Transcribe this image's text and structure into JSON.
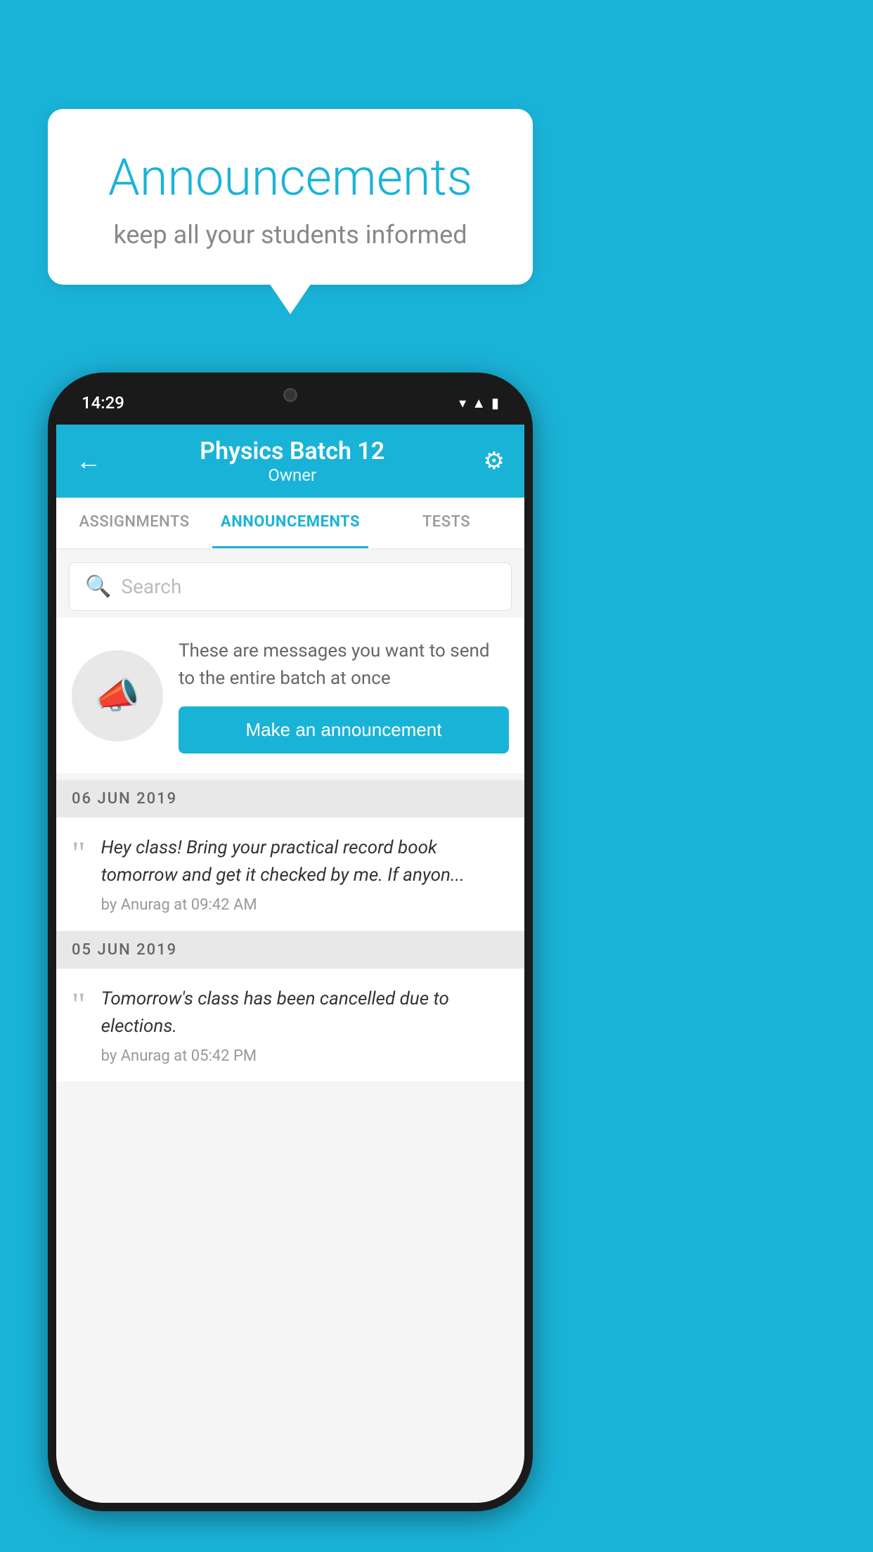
{
  "background_color": "#1ab3d8",
  "speech_bubble": {
    "title": "Announcements",
    "subtitle": "keep all your students informed"
  },
  "phone": {
    "status_bar": {
      "time": "14:29"
    },
    "header": {
      "title": "Physics Batch 12",
      "subtitle": "Owner",
      "back_label": "←"
    },
    "tabs": [
      {
        "label": "ASSIGNMENTS",
        "active": false
      },
      {
        "label": "ANNOUNCEMENTS",
        "active": true
      },
      {
        "label": "TESTS",
        "active": false
      }
    ],
    "search": {
      "placeholder": "Search"
    },
    "promo": {
      "description": "These are messages you want to send to the entire batch at once",
      "button_label": "Make an announcement"
    },
    "announcements": [
      {
        "date": "06  JUN  2019",
        "items": [
          {
            "text": "Hey class! Bring your practical record book tomorrow and get it checked by me. If anyon...",
            "meta": "by Anurag at 09:42 AM"
          }
        ]
      },
      {
        "date": "05  JUN  2019",
        "items": [
          {
            "text": "Tomorrow's class has been cancelled due to elections.",
            "meta": "by Anurag at 05:42 PM"
          }
        ]
      }
    ]
  }
}
